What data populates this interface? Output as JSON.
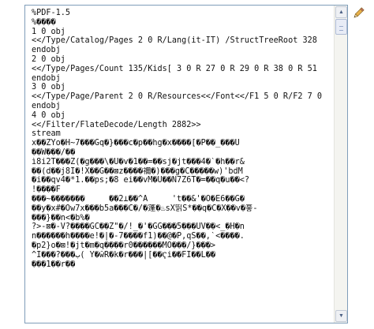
{
  "editor": {
    "lines": [
      "%PDF-1.5",
      "%����",
      "1 0 obj",
      "<</Type/Catalog/Pages 2 0 R/Lang(it-IT) /StructTreeRoot 328",
      "endobj",
      "2 0 obj",
      "<</Type/Pages/Count 135/Kids[ 3 0 R 27 0 R 29 0 R 38 0 R 51",
      "endobj",
      "3 0 obj",
      "<</Type/Page/Parent 2 0 R/Resources<</Font<</F1 5 0 R/F2 7 0",
      "endobj",
      "4 0 obj",
      "<</Filter/FlateDecode/Length 2882>>",
      "stream",
      "x��ZYo�H~7���Gq�}���c�p��hg�x����[�P��_���U",
      "��W���/��",
      "ì8i2T���Z(�g���\\�U�v�1��=��sj�jt���4�`�h��r&",
      "��(d��j8I�!X��G��⊠z����禰�)���g�C�����w)'bdM",
      "�i��qv4�*1.��ps;�8 ei��vM�U��N7Z6T�=��q�u��<?",
      "!����F",
      "���~�������     ��2⊥��^A     't��&'�O�E6��G�",
      "��y�x#�Ow7x���b5a���C�/�蓬�♨sX띩S*��q�C�X��v�흫-",
      "���}��n<�b%�",
      "?>-⊠�-V?����GC��Z\"�/!_�'�GG���5���UV��<_�H�n",
      "n������h����e!�|�-7����f1)��@�P,qS��,`<����.",
      "�p2}o�⊠!�jt�m�q����r0������MO���/}���>",
      "^I���?���ب( Y�ŵR�k�r���|[��Ҁi��FI��L��",
      "���1��r��"
    ]
  }
}
